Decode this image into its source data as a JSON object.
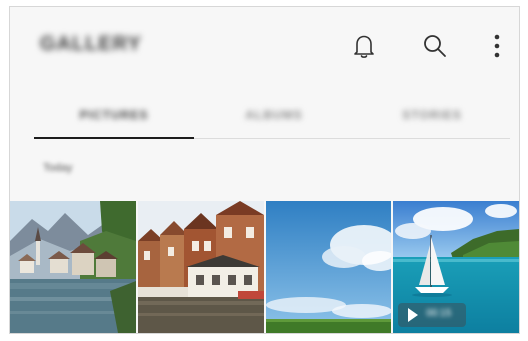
{
  "header": {
    "title": "GALLERY",
    "icons": [
      "bell-icon",
      "search-icon",
      "more-vert-icon"
    ]
  },
  "tabs": [
    {
      "label": "PICTURES",
      "selected": true
    },
    {
      "label": "ALBUMS",
      "selected": false
    },
    {
      "label": "STORIES",
      "selected": false
    }
  ],
  "section": {
    "title": "Today"
  },
  "photos": [
    {
      "name": "alpine-lake-village"
    },
    {
      "name": "canal-houses"
    },
    {
      "name": "blue-sky-meadow"
    },
    {
      "name": "sailboat-sea",
      "video": true,
      "duration": "00:15"
    }
  ],
  "colors": {
    "indicator": "#1d1d1d",
    "background": "#f7f7f7"
  }
}
